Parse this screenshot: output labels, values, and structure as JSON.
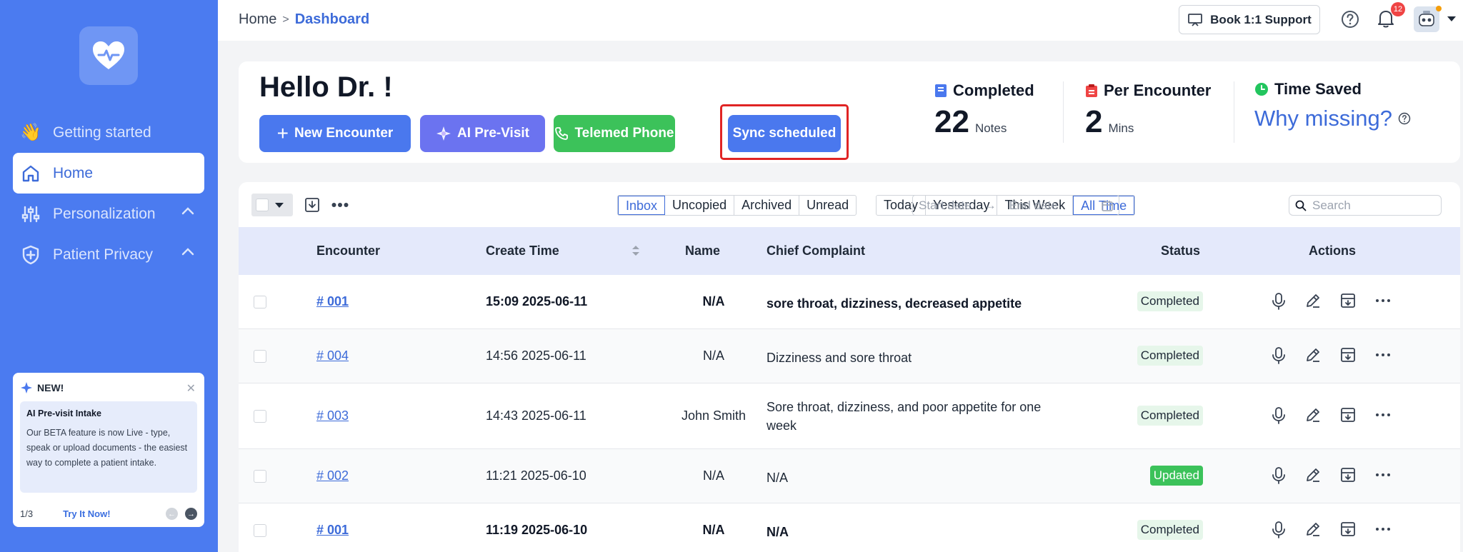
{
  "sidebar": {
    "items": [
      {
        "label": "Getting started",
        "emoji": "👋"
      },
      {
        "label": "Home"
      },
      {
        "label": "Personalization"
      },
      {
        "label": "Patient Privacy"
      }
    ],
    "promo": {
      "tag": "NEW!",
      "title": "AI Pre-visit Intake",
      "description": "Our BETA feature is now Live - type, speak or upload documents - the easiest way to complete a patient intake.",
      "page": "1/3",
      "cta": "Try It Now!"
    }
  },
  "topbar": {
    "breadcrumb_home": "Home",
    "breadcrumb_sep": ">",
    "breadcrumb_current": "Dashboard",
    "support_label": "Book 1:1 Support",
    "notification_count": "12"
  },
  "hello": {
    "greeting": "Hello Dr. !",
    "buttons": {
      "new_encounter": "New Encounter",
      "ai_previsit": "AI Pre-Visit",
      "telemed": "Telemed Phone",
      "sync": "Sync scheduled"
    },
    "stats": {
      "completed_label": "Completed",
      "completed_value": "22",
      "completed_unit": "Notes",
      "per_label": "Per Encounter",
      "per_value": "2",
      "per_unit": "Mins",
      "saved_label": "Time Saved",
      "saved_link": "Why missing?"
    }
  },
  "filters": {
    "tabs": [
      "Inbox",
      "Uncopied",
      "Archived",
      "Unread"
    ],
    "periods": [
      "Today",
      "Yesterday",
      "This Week",
      "All Time"
    ],
    "start_placeholder": "Start date",
    "end_placeholder": "End date",
    "search_placeholder": "Search"
  },
  "table": {
    "headers": {
      "encounter": "Encounter",
      "create_time": "Create Time",
      "name": "Name",
      "chief_complaint": "Chief Complaint",
      "status": "Status",
      "actions": "Actions"
    },
    "rows": [
      {
        "encounter": "# 001",
        "time": "15:09 2025-06-11",
        "name": "N/A",
        "complaint": "sore throat, dizziness, decreased appetite",
        "status": "Completed"
      },
      {
        "encounter": "# 004",
        "time": "14:56 2025-06-11",
        "name": "N/A",
        "complaint": "Dizziness and sore throat",
        "status": "Completed"
      },
      {
        "encounter": "# 003",
        "time": "14:43 2025-06-11",
        "name": "John Smith",
        "complaint": "Sore throat, dizziness, and poor appetite for one week",
        "status": "Completed"
      },
      {
        "encounter": "# 002",
        "time": "11:21 2025-06-10",
        "name": "N/A",
        "complaint": "N/A",
        "status": "Updated"
      },
      {
        "encounter": "# 001",
        "time": "11:19 2025-06-10",
        "name": "N/A",
        "complaint": "N/A",
        "status": "Completed"
      }
    ]
  }
}
